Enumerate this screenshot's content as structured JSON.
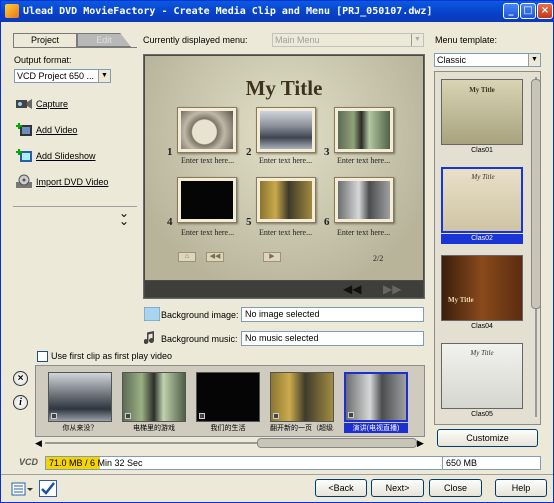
{
  "window": {
    "title": "Ulead DVD MovieFactory - Create Media Clip and Menu    [PRJ_050107.dwz]"
  },
  "titlebar_buttons": {
    "minimize": "_",
    "maximize": "□",
    "close": "×"
  },
  "tabs": {
    "project": "Project",
    "edit": "Edit"
  },
  "output_format": {
    "label": "Output format:",
    "value": "VCD Project 650 ..."
  },
  "actions": {
    "capture": "Capture",
    "add_video": "Add Video",
    "add_slideshow": "Add Slideshow",
    "import_dvd": "Import DVD Video"
  },
  "expand_glyph": "⌄",
  "menu_selector": {
    "label": "Currently displayed menu:",
    "value": "Main Menu"
  },
  "menu_preview": {
    "title": "My Title",
    "items": [
      {
        "num": "1",
        "caption": "Enter text here..."
      },
      {
        "num": "2",
        "caption": "Enter text here..."
      },
      {
        "num": "3",
        "caption": "Enter text here..."
      },
      {
        "num": "4",
        "caption": "Enter text here..."
      },
      {
        "num": "5",
        "caption": "Enter text here..."
      },
      {
        "num": "6",
        "caption": "Enter text here..."
      }
    ],
    "page": "2/2",
    "nav": {
      "home": "⌂",
      "prev": "◀◀",
      "next": "▶"
    },
    "stage_nav": {
      "prev": "◀◀",
      "next": "▶▶"
    }
  },
  "background_image": {
    "label": "Background image:",
    "value": "No image selected"
  },
  "background_music": {
    "label": "Background music:",
    "value": "No music selected"
  },
  "first_play": {
    "label": "Use first clip as first play video",
    "checked": false
  },
  "side_buttons": {
    "remove": "×",
    "info": "i"
  },
  "clips": [
    {
      "caption": "你从来没？",
      "selected": false
    },
    {
      "caption": "电梯里的游戏",
      "selected": false
    },
    {
      "caption": "我们的生活",
      "selected": false
    },
    {
      "caption": "翻开新的一页（超级...",
      "selected": false
    },
    {
      "caption": "演讲(电视直播)",
      "selected": true
    }
  ],
  "clip_scroll": {
    "left": "◀",
    "right": "▶"
  },
  "template_selector": {
    "label": "Menu template:",
    "value": "Classic"
  },
  "templates": [
    {
      "name": "Clas01",
      "title": "My Title",
      "selected": false
    },
    {
      "name": "Clas02",
      "title": "My Title",
      "selected": true
    },
    {
      "name": "Clas04",
      "title": "My Title",
      "selected": false
    },
    {
      "name": "Clas05",
      "title": "My Title",
      "selected": false
    }
  ],
  "customize_label": "Customize",
  "capacity": {
    "format": "VCD",
    "used_text": "71.0 MB / 6 Min 32 Sec",
    "total_text": "650 MB",
    "used_fraction": 0.109
  },
  "footer": {
    "back": "<Back",
    "next": "Next>",
    "close": "Close",
    "help": "Help"
  },
  "colors": {
    "titlebar": "#0a5ae0",
    "selection": "#1a35d6",
    "capacity_fill": "#f5d400"
  }
}
